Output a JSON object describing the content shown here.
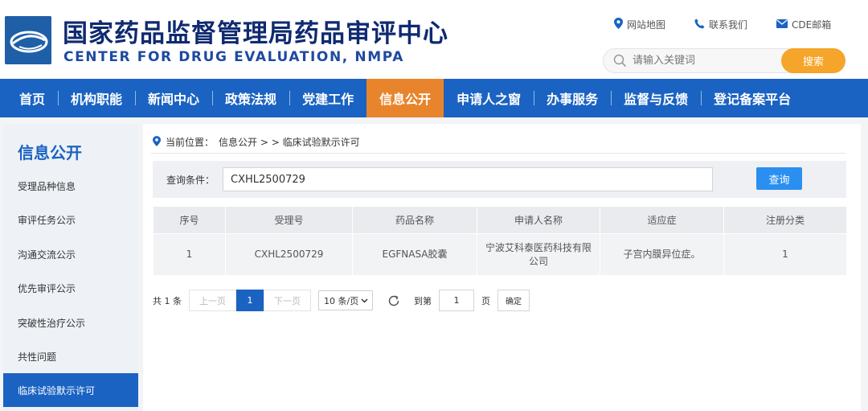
{
  "header": {
    "title_cn": "国家药品监督管理局药品审评中心",
    "title_en": "CENTER FOR DRUG EVALUATION, NMPA",
    "links": [
      {
        "icon": "location-pin-icon",
        "label": "网站地图"
      },
      {
        "icon": "phone-icon",
        "label": "联系我们"
      },
      {
        "icon": "mail-icon",
        "label": "CDE邮箱"
      }
    ],
    "search_placeholder": "请输入关键词",
    "search_button": "搜索"
  },
  "nav": {
    "items": [
      "首页",
      "机构职能",
      "新闻中心",
      "政策法规",
      "党建工作",
      "信息公开",
      "申请人之窗",
      "办事服务",
      "监督与反馈",
      "登记备案平台"
    ],
    "active": "信息公开"
  },
  "sidebar": {
    "title": "信息公开",
    "items": [
      "受理品种信息",
      "审评任务公示",
      "沟通交流公示",
      "优先审评公示",
      "突破性治疗公示",
      "共性问题",
      "临床试验默示许可"
    ],
    "active": "临床试验默示许可"
  },
  "breadcrumb": {
    "prefix": "当前位置：",
    "path": "信息公开 > > 临床试验默示许可"
  },
  "query": {
    "label": "查询条件：",
    "value": "CXHL2500729",
    "button": "查询"
  },
  "table": {
    "headers": [
      "序号",
      "受理号",
      "药品名称",
      "申请人名称",
      "适应症",
      "注册分类"
    ],
    "rows": [
      [
        "1",
        "CXHL2500729",
        "EGFNASA胶囊",
        "宁波艾科泰医药科技有限公司",
        "子宫内膜异位症。",
        "1"
      ]
    ]
  },
  "pager": {
    "total": "共 1 条",
    "prev": "上一页",
    "current": "1",
    "next": "下一页",
    "page_size": "10 条/页",
    "goto_label": "到第",
    "goto_value": "1",
    "page_unit": "页",
    "confirm": "确定"
  },
  "colors": {
    "brand_blue": "#1a63c2",
    "active_orange": "#e8852c",
    "search_orange": "#f5a52a",
    "query_button_blue": "#2a8ff0"
  }
}
